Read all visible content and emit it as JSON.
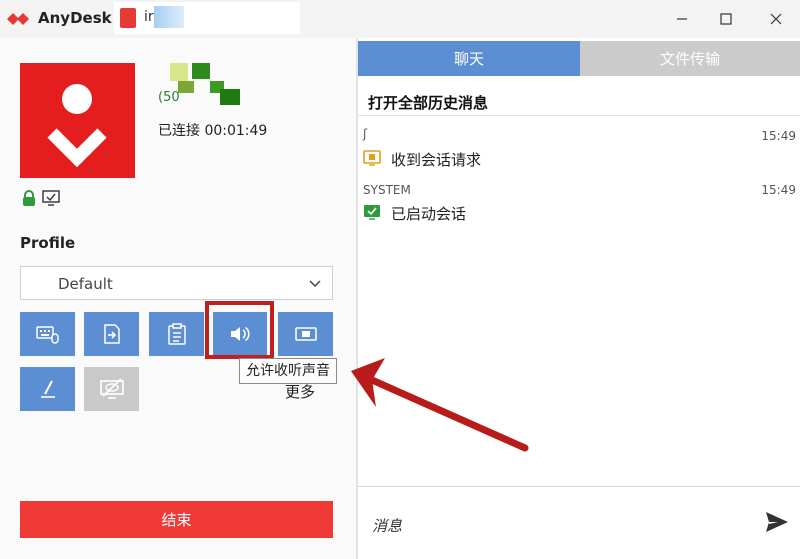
{
  "app": {
    "title": "AnyDesk"
  },
  "tab": {
    "label": "ir"
  },
  "window_controls": [
    "minimize",
    "maximize",
    "close"
  ],
  "session": {
    "remote_id_partial": "(50",
    "status": "已连接 00:01:49"
  },
  "profile": {
    "heading": "Profile",
    "selected": "Default"
  },
  "toolbar": {
    "tooltip": "允许收听声音",
    "more_label": "更多",
    "buttons": [
      {
        "name": "keyboard-mouse-button",
        "icon": "keyboard-mouse-icon"
      },
      {
        "name": "file-transfer-button",
        "icon": "file-arrow-icon"
      },
      {
        "name": "clipboard-button",
        "icon": "clipboard-icon"
      },
      {
        "name": "sound-button",
        "icon": "speaker-icon"
      },
      {
        "name": "record-button",
        "icon": "video-camera-icon"
      },
      {
        "name": "draw-button",
        "icon": "pen-icon"
      },
      {
        "name": "privacy-button",
        "icon": "monitor-hidden-icon",
        "disabled": true
      }
    ]
  },
  "end_button": "结束",
  "chat": {
    "tabs": [
      {
        "label": "聊天",
        "active": true
      },
      {
        "label": "文件传输",
        "active": false
      }
    ],
    "history_link": "打开全部历史消息",
    "messages": [
      {
        "sender": "ʃ",
        "time": "15:49",
        "text": "收到会话请求",
        "icon": "session-request-icon"
      },
      {
        "sender": "SYSTEM",
        "time": "15:49",
        "text": "已启动会话",
        "icon": "session-started-icon"
      }
    ],
    "input_placeholder": "消息"
  },
  "colors": {
    "accent": "#5b8ed3",
    "brand": "#e41e1e",
    "end": "#f03a38",
    "annotation": "#c0201e"
  }
}
